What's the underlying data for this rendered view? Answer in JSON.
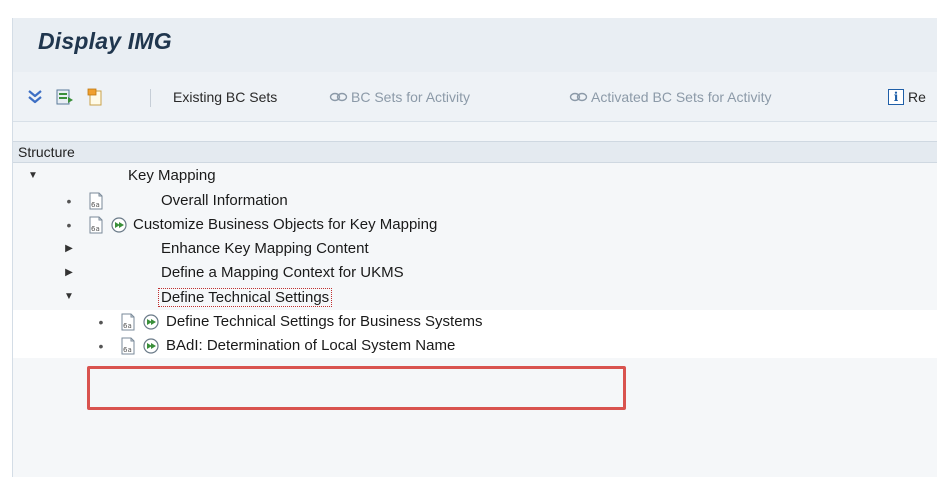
{
  "window": {
    "title": "Display IMG"
  },
  "toolbar": {
    "icons": [
      "expand-all-icon",
      "transport-icon",
      "document-icon"
    ],
    "existing_bc_sets": "Existing BC Sets",
    "bc_sets_for_activity": "BC Sets for Activity",
    "activated_bc_sets": "Activated BC Sets for Activity",
    "release_notes_partial": "Re",
    "info_glyph": "i"
  },
  "tree": {
    "header": "Structure",
    "rows": [
      {
        "label": "Key Mapping",
        "expanded": true
      },
      {
        "label": "Overall Information"
      },
      {
        "label": "Customize Business Objects for Key Mapping"
      },
      {
        "label": "Enhance Key Mapping Content",
        "expanded": false
      },
      {
        "label": "Define a Mapping Context for UKMS",
        "expanded": false
      },
      {
        "label": "Define Technical Settings",
        "expanded": true
      },
      {
        "label": "Define Technical Settings for Business Systems"
      },
      {
        "label": "BAdI: Determination of Local System Name"
      }
    ]
  },
  "colors": {
    "highlight": "#d9534f",
    "title": "#20364e",
    "exec_green": "#3a8f3a"
  }
}
